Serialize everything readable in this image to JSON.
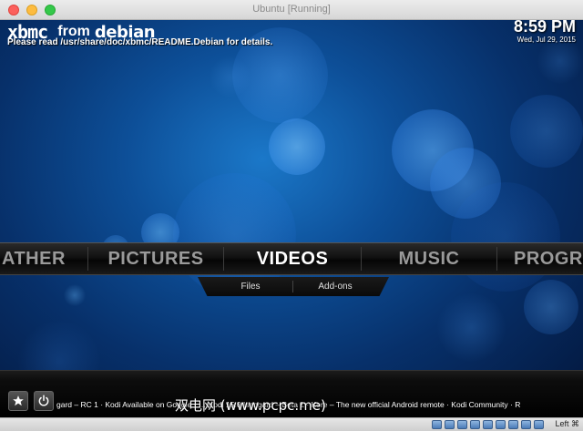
{
  "window": {
    "title": "Ubuntu [Running]"
  },
  "header": {
    "logo_text": "xbmc",
    "logo_from": "from",
    "logo_distro": "debian",
    "readme_notice": "Please read /usr/share/doc/xbmc/README.Debian for details.",
    "time": "8:59 PM",
    "date": "Wed, Jul 29, 2015"
  },
  "main_menu": {
    "items": [
      {
        "label": "ATHER",
        "active": false
      },
      {
        "label": "PICTURES",
        "active": false
      },
      {
        "label": "VIDEOS",
        "active": true
      },
      {
        "label": "MUSIC",
        "active": false
      },
      {
        "label": "PROGR",
        "active": false
      }
    ]
  },
  "submenu": {
    "items": [
      {
        "label": "Files"
      },
      {
        "label": "Add-ons"
      }
    ]
  },
  "bottom_bar": {
    "favourites_icon": "star-icon",
    "power_icon": "power-icon",
    "ticker": "gard – RC 1 · Kodi Available on Google · … Kodi 15.0 Isengard – Beta 1 · Kore – The new official Android remote · Kodi Community · R"
  },
  "watermark": {
    "text": "双电网 (www.pcpc.me)"
  },
  "vbox_status": {
    "host_key": "Left ⌘",
    "icons": [
      "hdd-icon",
      "optical-icon",
      "usb-icon",
      "shared-folder-icon",
      "display-icon",
      "capture-icon",
      "network-icon",
      "recording-icon",
      "cpu-icon",
      "mouse-icon"
    ]
  },
  "colors": {
    "menu_active": "#ffffff",
    "menu_inactive": "#9a9a9a",
    "background_accent": "#0d4f98"
  }
}
